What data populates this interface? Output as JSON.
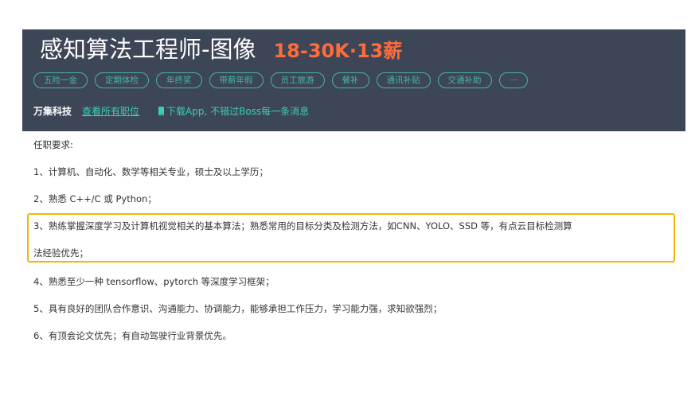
{
  "job": {
    "title": "感知算法工程师-图像",
    "salary": "18-30K·13薪"
  },
  "tags": [
    "五险一金",
    "定期体检",
    "年终奖",
    "带薪年假",
    "员工旅游",
    "餐补",
    "通讯补贴",
    "交通补助",
    "···"
  ],
  "company": {
    "name": "万集科技",
    "all_jobs_link": "查看所有职位",
    "download_app": "下载App, 不错过Boss每一条消息"
  },
  "requirements": {
    "heading": "任职要求:",
    "lines": [
      "1、计算机、自动化、数学等相关专业，硕士及以上学历；",
      "2、熟悉 C++/C 或 Python；",
      "3、熟练掌握深度学习及计算机视觉相关的基本算法；熟悉常用的目标分类及检测方法，如CNN、YOLO、SSD 等，有点云目标检测算",
      "法经验优先；",
      "4、熟悉至少一种 tensorflow、pytorch 等深度学习框架；",
      "5、具有良好的团队合作意识、沟通能力、协调能力，能够承担工作压力，学习能力强，求知欲强烈；",
      "6、有顶会论文优先；有自动驾驶行业背景优先。"
    ]
  },
  "colors": {
    "header_bg": "#3c4656",
    "salary": "#ff6c3a",
    "accent": "#3ecdb8",
    "highlight": "#f2b704"
  }
}
